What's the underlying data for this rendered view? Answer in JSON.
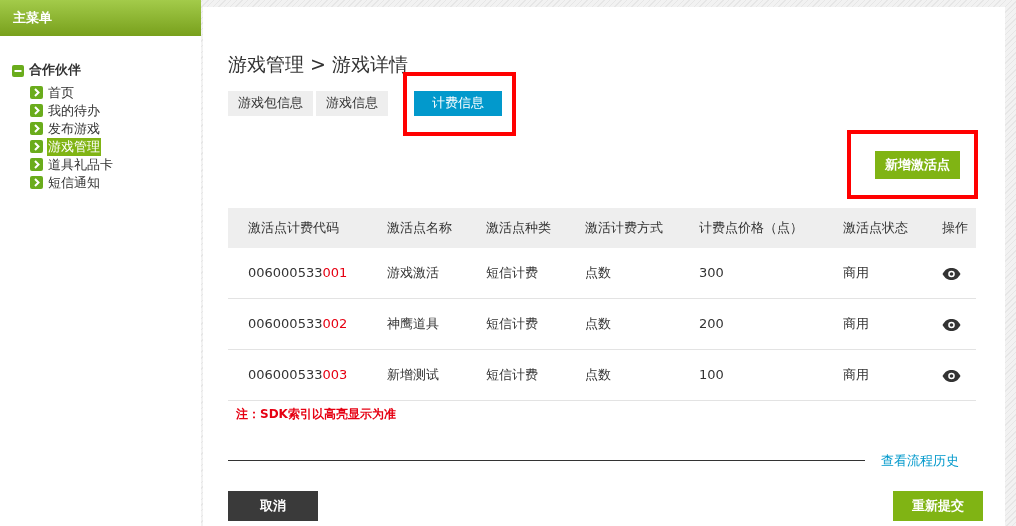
{
  "sidebar": {
    "title": "主菜单",
    "group": {
      "label": "合作伙伴",
      "expanded": true,
      "items": [
        {
          "label": "首页",
          "selected": false
        },
        {
          "label": "我的待办",
          "selected": false
        },
        {
          "label": "发布游戏",
          "selected": false
        },
        {
          "label": "游戏管理",
          "selected": true
        },
        {
          "label": "道具礼品卡",
          "selected": false
        },
        {
          "label": "短信通知",
          "selected": false
        }
      ]
    }
  },
  "breadcrumb": {
    "parent": "游戏管理",
    "separator": ">",
    "current": "游戏详情"
  },
  "tabs": [
    {
      "label": "游戏包信息",
      "selected": false,
      "highlighted": false
    },
    {
      "label": "游戏信息",
      "selected": false,
      "highlighted": false
    },
    {
      "label": "计费信息",
      "selected": true,
      "highlighted": true
    }
  ],
  "add_button": {
    "label": "新增激活点",
    "highlighted": true
  },
  "table": {
    "columns": [
      "激活点计费代码",
      "激活点名称",
      "激活点种类",
      "激活计费方式",
      "计费点价格（点）",
      "激活点状态",
      "操作"
    ],
    "rows": [
      {
        "code_prefix": "006000533",
        "code_suffix": "001",
        "name": "游戏激活",
        "type": "短信计费",
        "method": "点数",
        "price": "300",
        "status": "商用"
      },
      {
        "code_prefix": "006000533",
        "code_suffix": "002",
        "name": "神鹰道具",
        "type": "短信计费",
        "method": "点数",
        "price": "200",
        "status": "商用"
      },
      {
        "code_prefix": "006000533",
        "code_suffix": "003",
        "name": "新增测试",
        "type": "短信计费",
        "method": "点数",
        "price": "100",
        "status": "商用"
      }
    ]
  },
  "note": "注：SDK索引以高亮显示为准",
  "history_link": "查看流程历史",
  "buttons": {
    "cancel": "取消",
    "resubmit": "重新提交"
  }
}
